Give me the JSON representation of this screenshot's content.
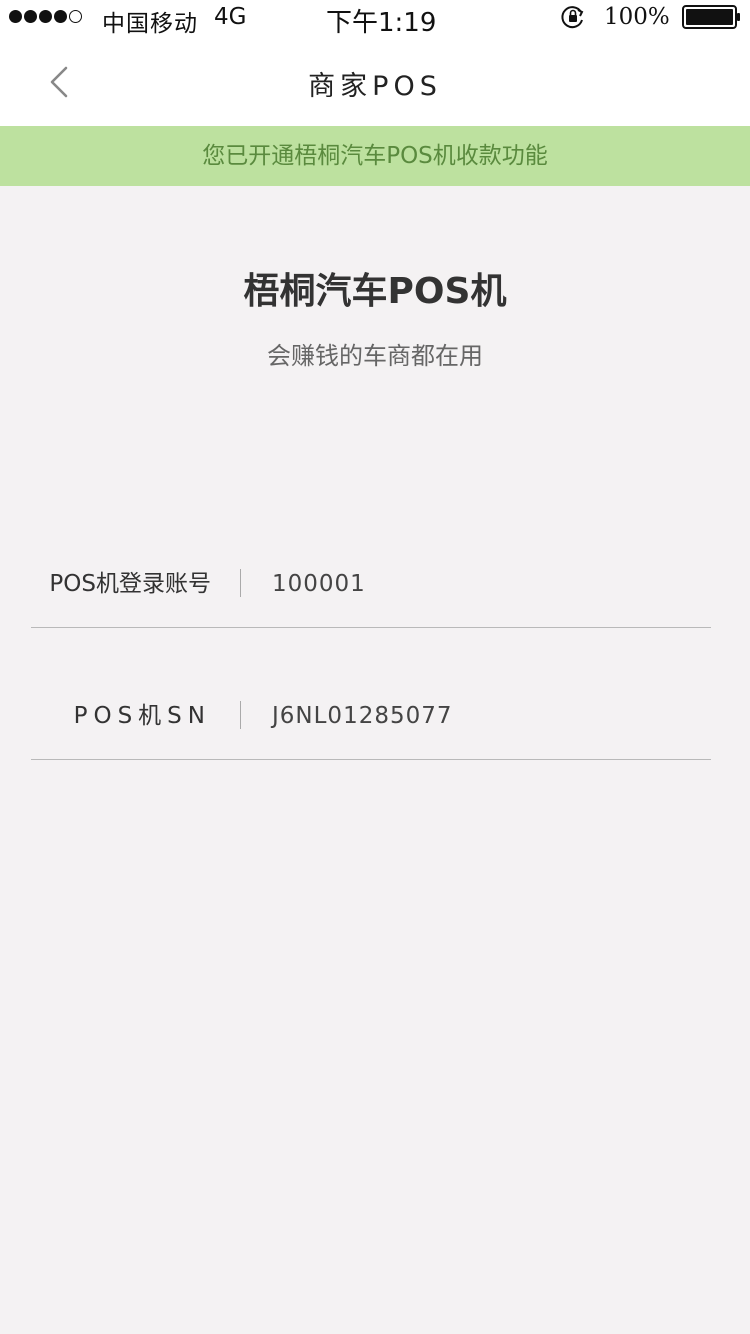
{
  "status_bar": {
    "carrier": "中国移动",
    "network": "4G",
    "time": "下午1:19",
    "battery_percent": "100%",
    "signal_dots_filled": 4,
    "signal_dots_total": 5
  },
  "nav": {
    "title": "商家POS",
    "back_icon": "chevron-left-icon"
  },
  "banner": {
    "text": "您已开通梧桐汽车POS机收款功能",
    "bg_color": "#bde19f",
    "text_color": "#5a8a3e"
  },
  "hero": {
    "title": "梧桐汽车POS机",
    "subtitle": "会赚钱的车商都在用"
  },
  "form": {
    "rows": [
      {
        "label": "POS机登录账号",
        "value": "100001"
      },
      {
        "label": "POS机SN",
        "value": "J6NL01285077"
      }
    ]
  },
  "colors": {
    "page_bg": "#f4f2f3",
    "header_bg": "#ffffff"
  }
}
